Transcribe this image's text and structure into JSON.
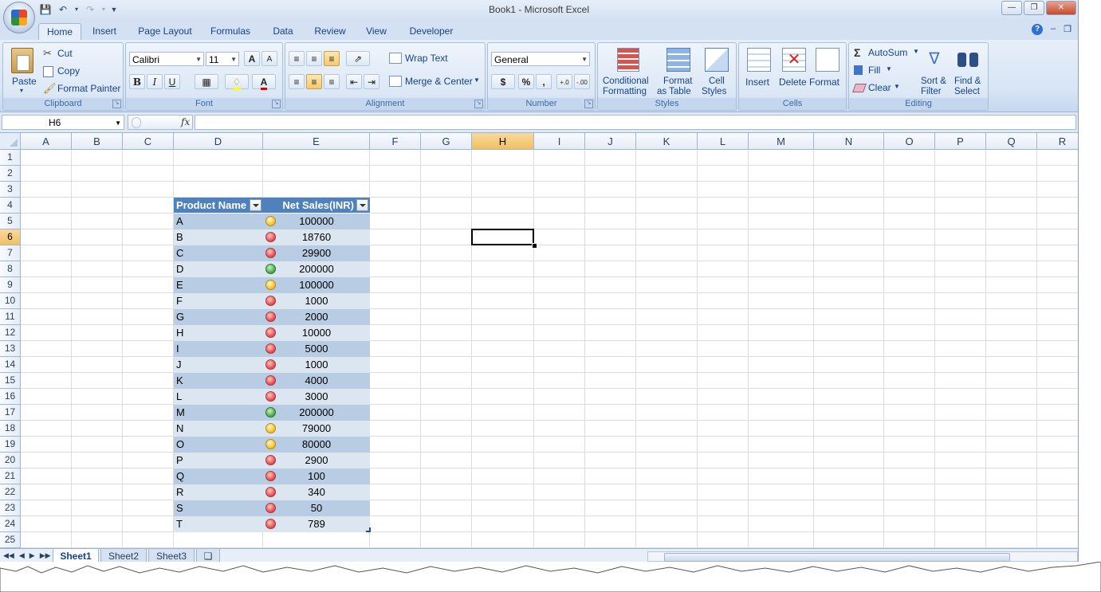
{
  "title": "Book1 - Microsoft Excel",
  "tabs": [
    "Home",
    "Insert",
    "Page Layout",
    "Formulas",
    "Data",
    "Review",
    "View",
    "Developer"
  ],
  "clipboard": {
    "paste": "Paste",
    "cut": "Cut",
    "copy": "Copy",
    "format_painter": "Format Painter",
    "label": "Clipboard"
  },
  "font": {
    "name": "Calibri",
    "size": "11",
    "label": "Font",
    "bold": "B",
    "italic": "I",
    "underline": "U",
    "grow": "A",
    "shrink": "A"
  },
  "alignment": {
    "wrap_text": "Wrap Text",
    "merge_center": "Merge & Center",
    "label": "Alignment"
  },
  "number": {
    "format": "General",
    "currency": "$",
    "percent": "%",
    "comma": ",",
    "inc_decimal": "+.0",
    "dec_decimal": "-.00",
    "label": "Number"
  },
  "styles": {
    "conditional_1": "Conditional",
    "conditional_2": "Formatting",
    "format_table_1": "Format",
    "format_table_2": "as Table",
    "cell_styles_1": "Cell",
    "cell_styles_2": "Styles",
    "label": "Styles"
  },
  "cells": {
    "insert": "Insert",
    "delete": "Delete",
    "format": "Format",
    "label": "Cells"
  },
  "editing": {
    "autosum": "AutoSum",
    "fill": "Fill",
    "clear": "Clear",
    "sort_1": "Sort &",
    "sort_2": "Filter",
    "find_1": "Find &",
    "find_2": "Select",
    "label": "Editing"
  },
  "formula_bar": {
    "name_box": "H6",
    "fx": "fx",
    "formula": ""
  },
  "columns": [
    "A",
    "B",
    "C",
    "D",
    "E",
    "F",
    "G",
    "H",
    "I",
    "J",
    "K",
    "L",
    "M",
    "N",
    "O",
    "P",
    "Q",
    "R"
  ],
  "selected_column": "H",
  "selected_row": 6,
  "rows": [
    "1",
    "2",
    "3",
    "4",
    "5",
    "6",
    "7",
    "8",
    "9",
    "10",
    "11",
    "12",
    "13",
    "14",
    "15",
    "16",
    "17",
    "18",
    "19",
    "20",
    "21",
    "22",
    "23",
    "24",
    "25"
  ],
  "table": {
    "headers": [
      "Product Name",
      "Net Sales(INR)"
    ],
    "rows": [
      {
        "product": "A",
        "sales": "100000",
        "icon": "yellow"
      },
      {
        "product": "B",
        "sales": "18760",
        "icon": "red"
      },
      {
        "product": "C",
        "sales": "29900",
        "icon": "red"
      },
      {
        "product": "D",
        "sales": "200000",
        "icon": "green"
      },
      {
        "product": "E",
        "sales": "100000",
        "icon": "yellow"
      },
      {
        "product": "F",
        "sales": "1000",
        "icon": "red"
      },
      {
        "product": "G",
        "sales": "2000",
        "icon": "red"
      },
      {
        "product": "H",
        "sales": "10000",
        "icon": "red"
      },
      {
        "product": "I",
        "sales": "5000",
        "icon": "red"
      },
      {
        "product": "J",
        "sales": "1000",
        "icon": "red"
      },
      {
        "product": "K",
        "sales": "4000",
        "icon": "red"
      },
      {
        "product": "L",
        "sales": "3000",
        "icon": "red"
      },
      {
        "product": "M",
        "sales": "200000",
        "icon": "green"
      },
      {
        "product": "N",
        "sales": "79000",
        "icon": "yellow"
      },
      {
        "product": "O",
        "sales": "80000",
        "icon": "yellow"
      },
      {
        "product": "P",
        "sales": "2900",
        "icon": "red"
      },
      {
        "product": "Q",
        "sales": "100",
        "icon": "red"
      },
      {
        "product": "R",
        "sales": "340",
        "icon": "red"
      },
      {
        "product": "S",
        "sales": "50",
        "icon": "red"
      },
      {
        "product": "T",
        "sales": "789",
        "icon": "red"
      }
    ]
  },
  "sheets": [
    "Sheet1",
    "Sheet2",
    "Sheet3"
  ],
  "active_sheet": "Sheet1",
  "colors": {
    "header_blue": "#4f81bd",
    "band_dark": "#b8cce4",
    "band_light": "#dce6f1",
    "selection_orange": "#f1c15f"
  }
}
